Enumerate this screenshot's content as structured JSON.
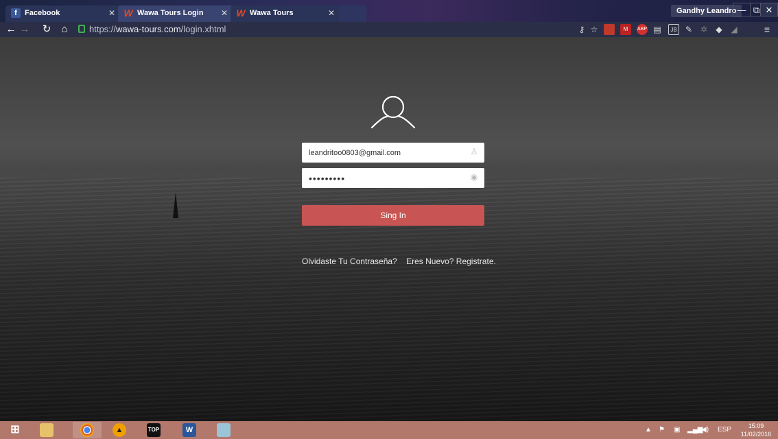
{
  "tabs": [
    {
      "label": "Facebook",
      "icon": "facebook-icon"
    },
    {
      "label": "Wawa Tours Login",
      "icon": "wawa-logo-icon"
    },
    {
      "label": "Wawa Tours",
      "icon": "wawa-logo-icon"
    }
  ],
  "profile": {
    "name": "Gandhy Leandro"
  },
  "window_controls": {
    "minimize": "—",
    "restore": "⧉",
    "close": "✕"
  },
  "address_bar": {
    "scheme": "https://",
    "host": "wawa-tours.com",
    "path": "/login.xhtml"
  },
  "login": {
    "email_value": "leandritoo0803@gmail.com",
    "password_value": "•••••••••",
    "signin_label": "Sing In",
    "forgot_link": "Olvidaste Tu Contraseña?",
    "register_link": "Eres Nuevo? Registrate."
  },
  "taskbar": {
    "language": "ESP",
    "time": "15:09",
    "date": "11/02/2016",
    "color": "#b2786c"
  },
  "colors": {
    "signin_button": "#c85553",
    "lock": "#3fb34f"
  }
}
